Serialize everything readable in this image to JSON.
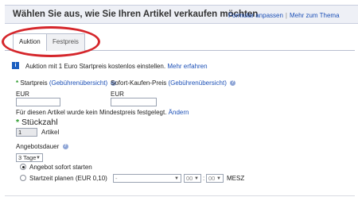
{
  "header": {
    "title": "Wählen Sie aus, wie Sie Ihren Artikel verkaufen möchten",
    "link_customize": "Formular anpassen",
    "separator": "|",
    "link_more": "Mehr zum Thema"
  },
  "tabs": [
    {
      "label": "Auktion",
      "active": true
    },
    {
      "label": "Festpreis",
      "active": false
    }
  ],
  "info": {
    "icon": "i",
    "text": "Auktion mit 1 Euro Startpreis kostenlos einstellen.",
    "link": "Mehr erfahren"
  },
  "startpreis": {
    "label": "Startpreis",
    "link": "(Gebührenübersicht)",
    "currency": "EUR",
    "value": ""
  },
  "sofortkaufen": {
    "label": "Sofort-Kaufen-Preis",
    "link": "(Gebührenübersicht)",
    "currency": "EUR",
    "value": ""
  },
  "mindestpreis": {
    "text": "Für diesen Artikel wurde kein Mindestpreis festgelegt.",
    "link": "Ändern"
  },
  "stueckzahl": {
    "label": "Stückzahl",
    "value": "1",
    "unit": "Artikel"
  },
  "angebotsdauer": {
    "label": "Angebotsdauer",
    "selected": "3 Tage"
  },
  "start": {
    "option_now": "Angebot sofort starten",
    "option_plan": "Startzeit planen (EUR 0,10)",
    "date_value": "-",
    "hour_value": "00",
    "minute_value": "00",
    "timezone": "MESZ",
    "selected": "now"
  },
  "colors": {
    "accent_link": "#1b4fb6",
    "required_mark": "#2a9a2a",
    "annotation_oval": "#d5262b"
  }
}
